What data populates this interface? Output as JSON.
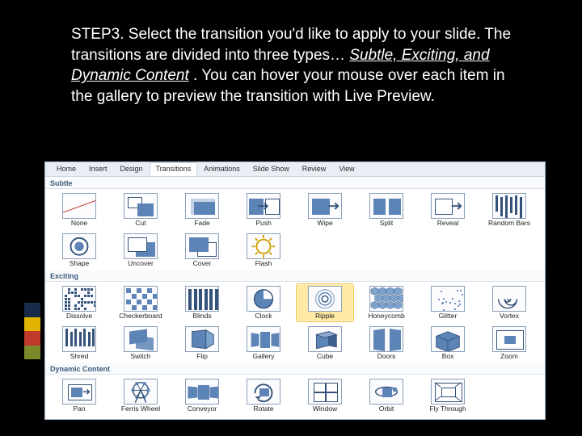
{
  "instruction": {
    "step_prefix": "STEP3.",
    "body_before": " Select the transition you'd like to apply to your slide. The transitions are divided into three types…",
    "italic_types": "Subtle, Exciting, and Dynamic Content",
    "body_after": ". You can hover your mouse over each item in the gallery to preview the transition with Live Preview."
  },
  "accent_colors": [
    "#1a2a4a",
    "#e0b400",
    "#c0392b",
    "#7a8a2a"
  ],
  "ribbon": {
    "tabs": [
      {
        "label": "Home",
        "active": false
      },
      {
        "label": "Insert",
        "active": false
      },
      {
        "label": "Design",
        "active": false
      },
      {
        "label": "Transitions",
        "active": true
      },
      {
        "label": "Animations",
        "active": false
      },
      {
        "label": "Slide Show",
        "active": false
      },
      {
        "label": "Review",
        "active": false
      },
      {
        "label": "View",
        "active": false
      }
    ]
  },
  "gallery": {
    "groups": [
      {
        "title": "Subtle",
        "items": [
          {
            "label": "None",
            "icon": "none"
          },
          {
            "label": "Cut",
            "icon": "cut"
          },
          {
            "label": "Fade",
            "icon": "fade"
          },
          {
            "label": "Push",
            "icon": "push"
          },
          {
            "label": "Wipe",
            "icon": "wipe"
          },
          {
            "label": "Split",
            "icon": "split"
          },
          {
            "label": "Reveal",
            "icon": "reveal"
          },
          {
            "label": "Random Bars",
            "icon": "randombars"
          },
          {
            "label": "Shape",
            "icon": "shape"
          },
          {
            "label": "Uncover",
            "icon": "uncover"
          },
          {
            "label": "Cover",
            "icon": "cover"
          },
          {
            "label": "Flash",
            "icon": "flash"
          }
        ]
      },
      {
        "title": "Exciting",
        "items": [
          {
            "label": "Dissolve",
            "icon": "dissolve"
          },
          {
            "label": "Checkerboard",
            "icon": "checkerboard"
          },
          {
            "label": "Blinds",
            "icon": "blinds"
          },
          {
            "label": "Clock",
            "icon": "clock"
          },
          {
            "label": "Ripple",
            "icon": "ripple",
            "highlight": true
          },
          {
            "label": "Honeycomb",
            "icon": "honeycomb"
          },
          {
            "label": "Glitter",
            "icon": "glitter"
          },
          {
            "label": "Vortex",
            "icon": "vortex"
          },
          {
            "label": "Shred",
            "icon": "shred"
          },
          {
            "label": "Switch",
            "icon": "switch"
          },
          {
            "label": "Flip",
            "icon": "flip"
          },
          {
            "label": "Gallery",
            "icon": "gallery"
          },
          {
            "label": "Cube",
            "icon": "cube"
          },
          {
            "label": "Doors",
            "icon": "doors"
          },
          {
            "label": "Box",
            "icon": "box"
          },
          {
            "label": "Zoom",
            "icon": "zoom"
          }
        ]
      },
      {
        "title": "Dynamic Content",
        "items": [
          {
            "label": "Pan",
            "icon": "pan"
          },
          {
            "label": "Ferris Wheel",
            "icon": "ferris"
          },
          {
            "label": "Conveyor",
            "icon": "conveyor"
          },
          {
            "label": "Rotate",
            "icon": "rotate"
          },
          {
            "label": "Window",
            "icon": "window"
          },
          {
            "label": "Orbit",
            "icon": "orbit"
          },
          {
            "label": "Fly Through",
            "icon": "flythrough"
          }
        ]
      }
    ]
  }
}
